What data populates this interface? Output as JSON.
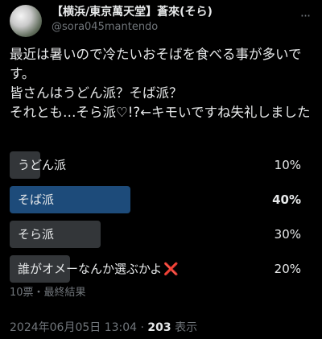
{
  "author": {
    "display_name": "【横浜/東京萬天堂】蒼來(そら)",
    "handle": "@sora045mantendo"
  },
  "more_icon": "more-horizontal-icon",
  "tweet": {
    "line1": "最近は暑いので冷たいおそばを食べる事が多いです。",
    "line2": "皆さんはうどん派？そば派？",
    "line3": "それとも…そら派♡!?←キモいですね失礼しました"
  },
  "poll": {
    "options": [
      {
        "label": "うどん派",
        "percent": "10%",
        "fraction": 0.1,
        "winner": false
      },
      {
        "label": "そば派",
        "percent": "40%",
        "fraction": 0.4,
        "winner": true
      },
      {
        "label": "そら派",
        "percent": "30%",
        "fraction": 0.3,
        "winner": false
      },
      {
        "label": "誰がオメーなんか選ぶかよ",
        "suffix_icon": "❌",
        "percent": "20%",
        "fraction": 0.2,
        "winner": false
      }
    ],
    "meta": "10票・最終結果"
  },
  "footer": {
    "timestamp": "2024年06月05日 13:04 · ",
    "views_count": "203",
    "views_label": " 表示"
  },
  "colors": {
    "winner_bar": "#1d4b7a",
    "other_bar": "#333639",
    "text": "#e7e9ea",
    "muted": "#71767b"
  }
}
